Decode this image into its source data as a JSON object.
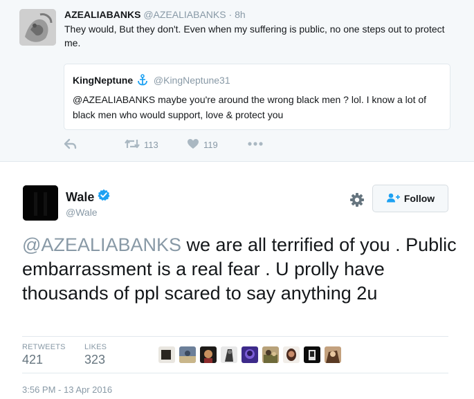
{
  "parent_tweet": {
    "author_name": "AZEALIABANKS",
    "author_handle": "@AZEALIABANKS",
    "separator": "·",
    "time": "8h",
    "text": "They would, But they don't. Even when my suffering is public, no one steps out to protect me.",
    "quote": {
      "author_name": "KingNeptune",
      "badge_icon": "anchor-icon",
      "author_handle": "@KingNeptune31",
      "text": "@AZEALIABANKS maybe you're around the wrong black men ? lol. I know a lot of black men who would support, love & protect you"
    },
    "actions": {
      "reply_icon": "reply-icon",
      "retweet_icon": "retweet-icon",
      "retweet_count": "113",
      "like_icon": "heart-icon",
      "like_count": "119",
      "more_icon": "more-dots-icon"
    }
  },
  "main_tweet": {
    "author_name": "Wale",
    "verified_icon": "verified-badge-icon",
    "author_handle": "@Wale",
    "settings_icon": "gear-icon",
    "follow_label": "Follow",
    "follow_icon": "add-user-icon",
    "mention": "@AZEALIABANKS",
    "text": " we are all terrified of you . Public embarrassment is a real fear . U prolly have thousands of ppl scared to say anything 2u",
    "stats": {
      "retweets_label": "RETWEETS",
      "retweets_value": "421",
      "likes_label": "LIKES",
      "likes_value": "323"
    },
    "timestamp": "3:56 PM - 13 Apr 2016"
  },
  "colors": {
    "muted": "#8899a6",
    "accent": "#1da1f2",
    "parent_bg": "#f5f8fa",
    "border": "#e1e8ed"
  }
}
